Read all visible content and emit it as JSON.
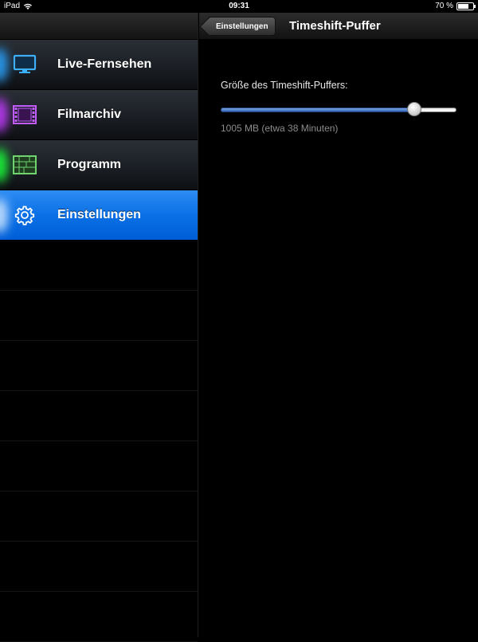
{
  "status_bar": {
    "device": "iPad",
    "time": "09:31",
    "battery_text": "70 %",
    "battery_level": 0.7
  },
  "sidebar": {
    "items": [
      {
        "label": "Live-Fernsehen",
        "icon": "tv-icon",
        "glow_color": "#2aa3ff",
        "active": false
      },
      {
        "label": "Filmarchiv",
        "icon": "film-icon",
        "glow_color": "#c23bff",
        "active": false
      },
      {
        "label": "Programm",
        "icon": "program-grid-icon",
        "glow_color": "#1aff3a",
        "active": false
      },
      {
        "label": "Einstellungen",
        "icon": "gear-icon",
        "glow_color": "#9fd0ff",
        "active": true
      }
    ]
  },
  "navbar": {
    "back_label": "Einstellungen",
    "title": "Timeshift-Puffer"
  },
  "content": {
    "setting_label": "Größe des Timeshift-Puffers:",
    "slider_value": 0.82,
    "value_text": "1005 MB (etwa 38 Minuten)"
  },
  "colors": {
    "active_blue": "#0a70e6",
    "slider_fill": "#3b6fc4"
  }
}
